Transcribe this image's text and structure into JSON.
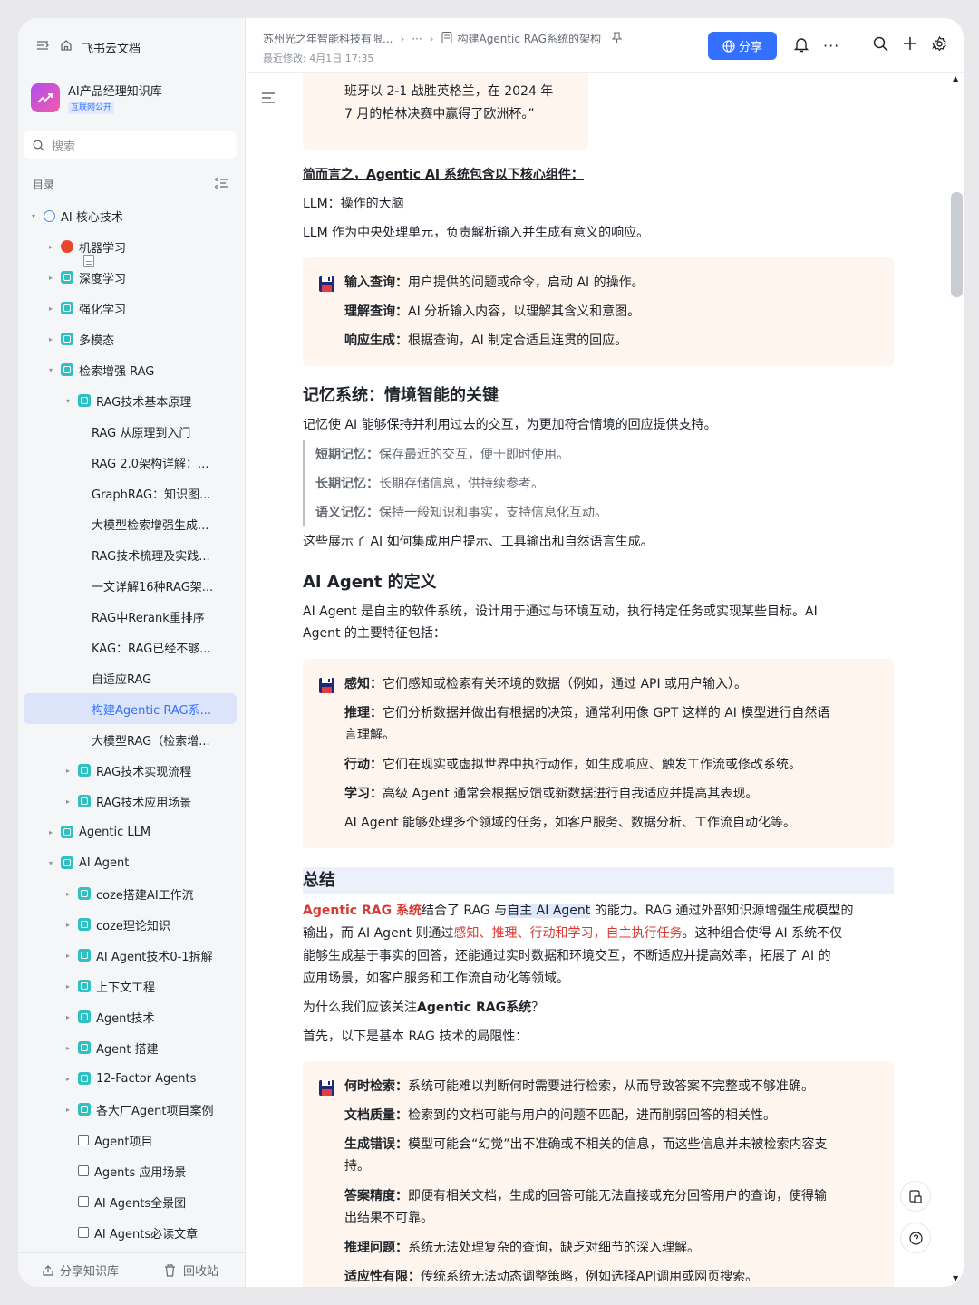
{
  "sidebar": {
    "top_label": "飞书云文档",
    "kb_name": "AI产品经理知识库",
    "kb_tag": "互联网公开",
    "search_placeholder": "搜索",
    "toc_label": "目录",
    "items": [
      {
        "label": "AI 核心技术",
        "depth": 0,
        "arrow": "▾",
        "icon": "globe"
      },
      {
        "label": "机器学习",
        "depth": 1,
        "arrow": "▸",
        "icon": "bot"
      },
      {
        "label": "深度学习",
        "depth": 1,
        "arrow": "▸",
        "icon": "cyan"
      },
      {
        "label": "强化学习",
        "depth": 1,
        "arrow": "▸",
        "icon": "cyan"
      },
      {
        "label": "多模态",
        "depth": 1,
        "arrow": "▸",
        "icon": "cyan"
      },
      {
        "label": "检索增强 RAG",
        "depth": 1,
        "arrow": "▾",
        "icon": "cyan"
      },
      {
        "label": "RAG技术基本原理",
        "depth": 2,
        "arrow": "▾",
        "icon": "cyan"
      },
      {
        "label": "RAG 从原理到入门",
        "depth": 3,
        "arrow": "",
        "icon": "doc"
      },
      {
        "label": "RAG 2.0架构详解：...",
        "depth": 3,
        "arrow": "",
        "icon": "doc"
      },
      {
        "label": "GraphRAG：知识图...",
        "depth": 3,
        "arrow": "",
        "icon": "doc"
      },
      {
        "label": "大模型检索增强生成...",
        "depth": 3,
        "arrow": "",
        "icon": "doc"
      },
      {
        "label": "RAG技术梳理及实践...",
        "depth": 3,
        "arrow": "",
        "icon": "doc"
      },
      {
        "label": "一文详解16种RAG架...",
        "depth": 3,
        "arrow": "",
        "icon": "doc"
      },
      {
        "label": "RAG中Rerank重排序",
        "depth": 3,
        "arrow": "",
        "icon": "doc"
      },
      {
        "label": "KAG：RAG已经不够...",
        "depth": 3,
        "arrow": "",
        "icon": "doc"
      },
      {
        "label": "自适应RAG",
        "depth": 3,
        "arrow": "",
        "icon": "doc"
      },
      {
        "label": "构建Agentic RAG系...",
        "depth": 3,
        "arrow": "",
        "icon": "doc",
        "selected": true
      },
      {
        "label": "大模型RAG（检索增...",
        "depth": 3,
        "arrow": "",
        "icon": "doc"
      },
      {
        "label": "RAG技术实现流程",
        "depth": 2,
        "arrow": "▸",
        "icon": "cyan"
      },
      {
        "label": "RAG技术应用场景",
        "depth": 2,
        "arrow": "▸",
        "icon": "cyan"
      },
      {
        "label": "Agentic LLM",
        "depth": 1,
        "arrow": "▸",
        "icon": "cyan"
      },
      {
        "label": "AI Agent",
        "depth": 1,
        "arrow": "▾",
        "icon": "cyan"
      },
      {
        "label": "coze搭建AI工作流",
        "depth": 2,
        "arrow": "▸",
        "icon": "cyan"
      },
      {
        "label": "coze理论知识",
        "depth": 2,
        "arrow": "▸",
        "icon": "cyan"
      },
      {
        "label": "AI Agent技术0-1拆解",
        "depth": 2,
        "arrow": "▸",
        "icon": "cyan"
      },
      {
        "label": "上下文工程",
        "depth": 2,
        "arrow": "▸",
        "icon": "cyan"
      },
      {
        "label": "Agent技术",
        "depth": 2,
        "arrow": "▸",
        "icon": "cyan"
      },
      {
        "label": "Agent 搭建",
        "depth": 2,
        "arrow": "▸",
        "icon": "cyan"
      },
      {
        "label": "12-Factor Agents",
        "depth": 2,
        "arrow": "▸",
        "icon": "cyan"
      },
      {
        "label": "各大厂Agent项目案例",
        "depth": 2,
        "arrow": "▸",
        "icon": "cyan"
      },
      {
        "label": "Agent项目",
        "depth": 2,
        "arrow": "",
        "icon": "box"
      },
      {
        "label": "Agents 应用场景",
        "depth": 2,
        "arrow": "",
        "icon": "box"
      },
      {
        "label": "AI Agents全景图",
        "depth": 2,
        "arrow": "",
        "icon": "box"
      },
      {
        "label": "AI Agents必读文章",
        "depth": 2,
        "arrow": "",
        "icon": "box"
      }
    ],
    "footer_share": "分享知识库",
    "footer_trash": "回收站"
  },
  "header": {
    "crumb1": "苏州光之年智能科技有限...",
    "crumb_more": "···",
    "crumb_doc": "构建Agentic RAG系统的架构",
    "last_modified": "最近修改: 4月1日 17:35",
    "share_label": "分享"
  },
  "doc": {
    "quote_top_1": "班牙以 2-1 战胜英格兰，在 2024 年",
    "quote_top_2": "7 月的柏林决赛中赢得了欧洲杯。”",
    "core_title": "简而言之，Agentic AI 系统包含以下核心组件：",
    "llm_line": "LLM：操作的大脑",
    "llm_desc": "LLM 作为中央处理单元，负责解析输入并生成有意义的响应。",
    "c1": [
      {
        "k": "输入查询：",
        "v": "用户提供的问题或命令，启动 AI 的操作。"
      },
      {
        "k": "理解查询：",
        "v": "AI 分析输入内容，以理解其含义和意图。"
      },
      {
        "k": "响应生成：",
        "v": "根据查询，AI 制定合适且连贯的回应。"
      }
    ],
    "mem_title": "记忆系统：情境智能的关键",
    "mem_desc": "记忆使 AI 能够保持并利用过去的交互，为更加符合情境的回应提供支持。",
    "mem_items": [
      {
        "k": "短期记忆：",
        "v": "保存最近的交互，便于即时使用。"
      },
      {
        "k": "长期记忆：",
        "v": "长期存储信息，供持续参考。"
      },
      {
        "k": "语义记忆：",
        "v": "保持一般知识和事实，支持信息化互动。"
      }
    ],
    "mem_after": "这些展示了 AI 如何集成用户提示、工具输出和自然语言生成。",
    "agent_title": "AI Agent 的定义",
    "agent_desc_1": "AI Agent 是自主的软件系统，设计用于通过与环境互动，执行特定任务或实现某些目标。AI",
    "agent_desc_2": "Agent 的主要特征包括：",
    "c2_sense_k": "感知：",
    "c2_sense_v": "它们感知或检索有关环境的数据（例如，通过 API 或用户输入）。",
    "c2_reason_k": "推理：",
    "c2_reason_v1": "它们分析数据并做出有根据的决策，通常利用像 GPT 这样的 AI 模型进行自然语",
    "c2_reason_v2": "言理解。",
    "c2_act_k": "行动：",
    "c2_act_v": "它们在现实或虚拟世界中执行动作，如生成响应、触发工作流或修改系统。",
    "c2_learn_k": "学习：",
    "c2_learn_v": "高级 Agent 通常会根据反馈或新数据进行自我适应并提高其表现。",
    "c2_end": "AI Agent 能够处理多个领域的任务，如客户服务、数据分析、工作流自动化等。",
    "sum_title": "总结",
    "sum_p1_a": "Agentic RAG 系统",
    "sum_p1_b": "结合了 RAG 与",
    "sum_p1_c": "自主 AI Agent",
    "sum_p1_d": " 的能力。RAG 通过外部知识源增强生成模型的",
    "sum_p2_a": "输出，而 AI Agent 则通过",
    "sum_p2_b": "感知、推理、行动和学习，自主执行任务",
    "sum_p2_c": "。这种组合使得 AI 系统不仅",
    "sum_p3": "能够生成基于事实的回答，还能通过实时数据和环境交互，不断适应并提高效率，拓展了 AI 的",
    "sum_p4": "应用场景，如客户服务和工作流自动化等领域。",
    "why_a": "为什么我们应该关注",
    "why_b": "Agentic RAG系统",
    "why_c": "？",
    "first": "首先，以下是基本 RAG 技术的局限性：",
    "c3_when_k": "何时检索：",
    "c3_when_v": "系统可能难以判断何时需要进行检索，从而导致答案不完整或不够准确。",
    "c3_quality_k": "文档质量：",
    "c3_quality_v": "检索到的文档可能与用户的问题不匹配，进而削弱回答的相关性。",
    "c3_gen_k": "生成错误：",
    "c3_gen_v1": "模型可能会“幻觉”出不准确或不相关的信息，而这些信息并未被检索内容支",
    "c3_gen_v2": "持。",
    "c3_prec_k": "答案精度：",
    "c3_prec_v1": "即便有相关文档，生成的回答可能无法直接或充分回答用户的查询，使得输",
    "c3_prec_v2": "出结果不可靠。",
    "c3_reason_k": "推理问题：",
    "c3_reason_v": "系统无法处理复杂的查询，缺乏对细节的深入理解。",
    "c3_adapt_k": "适应性有限：",
    "c3_adapt_v": "传统系统无法动态调整策略，例如选择API调用或网页搜索。"
  },
  "colors": {
    "accent": "#3370ff",
    "callout_bg": "#fef6ee",
    "highlight_red": "#d83931",
    "selected_bg": "#dce4fa"
  }
}
